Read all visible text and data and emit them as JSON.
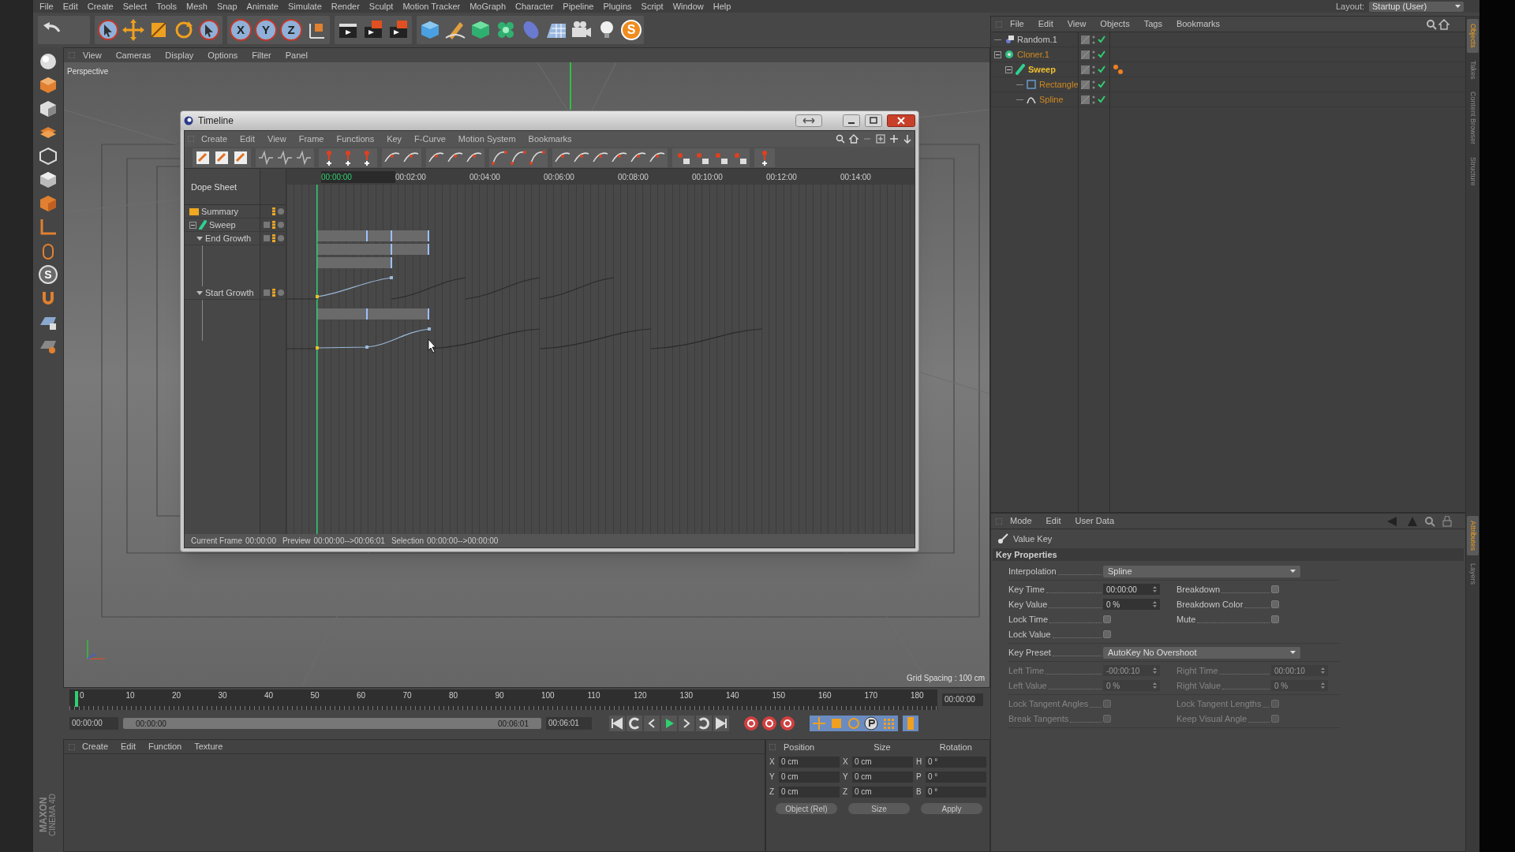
{
  "menu_bar": [
    "File",
    "Edit",
    "Create",
    "Select",
    "Tools",
    "Mesh",
    "Snap",
    "Animate",
    "Simulate",
    "Render",
    "Sculpt",
    "Motion Tracker",
    "MoGraph",
    "Character",
    "Pipeline",
    "Plugins",
    "Script",
    "Window",
    "Help"
  ],
  "layout": {
    "label": "Layout:",
    "value": "Startup (User)"
  },
  "main_toolbar": {
    "axis_buttons": [
      {
        "label": "X",
        "on": true
      },
      {
        "label": "Y",
        "on": true
      },
      {
        "label": "Z",
        "on": true
      }
    ],
    "badge": "S"
  },
  "left_toolbar": {
    "badge": "S"
  },
  "logo": [
    "MAXON",
    "CINEMA 4D"
  ],
  "viewport": {
    "menu": [
      "View",
      "Cameras",
      "Display",
      "Options",
      "Filter",
      "Panel"
    ],
    "label": "Perspective",
    "grid_spacing": "Grid Spacing : 100 cm"
  },
  "timeline_window": {
    "title": "Timeline",
    "menu": [
      "Create",
      "Edit",
      "View",
      "Frame",
      "Functions",
      "Key",
      "F-Curve",
      "Motion System",
      "Bookmarks"
    ],
    "mode": "Dope Sheet",
    "ruler": [
      "00:00:00",
      "00:02:00",
      "00:04:00",
      "00:06:00",
      "00:08:00",
      "00:10:00",
      "00:12:00",
      "00:14:00"
    ],
    "tracks": [
      {
        "name": "Summary",
        "kind": "summary"
      },
      {
        "name": "Sweep",
        "kind": "object",
        "expanded": true,
        "children": [
          {
            "name": "End Growth",
            "kind": "track",
            "expanded": true
          },
          {
            "name": "Start Growth",
            "kind": "track",
            "expanded": true
          }
        ]
      }
    ],
    "status": [
      {
        "label": "Current Frame",
        "value": "00:00:00"
      },
      {
        "label": "Preview",
        "value": "00:00:00-->00:06:01"
      },
      {
        "label": "Selection",
        "value": "00:00:00-->00:00:00"
      }
    ]
  },
  "object_manager": {
    "menu": [
      "File",
      "Edit",
      "View",
      "Objects",
      "Tags",
      "Bookmarks"
    ],
    "objects": [
      {
        "name": "Random.1",
        "kind": "effector",
        "selected": false,
        "animated": false
      },
      {
        "name": "Cloner.1",
        "kind": "cloner",
        "selected": true,
        "animated": false,
        "expanded": true,
        "children": [
          {
            "name": "Sweep",
            "kind": "sweep",
            "selected": true,
            "active": true,
            "animated": true,
            "expanded": true,
            "children": [
              {
                "name": "Rectangle",
                "kind": "rectangle",
                "selected": true,
                "animated": false
              },
              {
                "name": "Spline",
                "kind": "spline",
                "selected": true,
                "animated": false
              }
            ]
          }
        ]
      }
    ]
  },
  "object_tabs": [
    {
      "label": "Objects",
      "selected": true
    },
    {
      "label": "Takes",
      "selected": false
    },
    {
      "label": "Content Browser",
      "selected": false
    },
    {
      "label": "Structure",
      "selected": false
    }
  ],
  "attribute_tabs": [
    {
      "label": "Attributes",
      "selected": true
    },
    {
      "label": "Layers",
      "selected": false
    }
  ],
  "attributes": {
    "menu": [
      "Mode",
      "Edit",
      "User Data"
    ],
    "title": "Value Key",
    "section": "Key Properties",
    "groups": [
      [
        [
          {
            "kind": "dropdown",
            "label": "Interpolation",
            "value": "Spline",
            "disabled": false
          }
        ]
      ],
      [
        [
          {
            "kind": "field",
            "label": "Key Time",
            "value": "00:00:00",
            "disabled": false
          },
          {
            "kind": "checkbox",
            "label": "Breakdown",
            "checked": false,
            "disabled": false
          }
        ],
        [
          {
            "kind": "field",
            "label": "Key Value",
            "value": "0 %",
            "disabled": false
          },
          {
            "kind": "checkbox",
            "label": "Breakdown Color",
            "checked": false,
            "disabled": false
          }
        ],
        [
          {
            "kind": "checkbox",
            "label": "Lock Time",
            "checked": false,
            "disabled": false
          },
          {
            "kind": "checkbox",
            "label": "Mute",
            "checked": false,
            "disabled": false
          }
        ],
        [
          {
            "kind": "checkbox",
            "label": "Lock Value",
            "checked": false,
            "disabled": false
          }
        ]
      ],
      [
        [
          {
            "kind": "dropdown",
            "label": "Key Preset",
            "value": "AutoKey No Overshoot",
            "disabled": false
          }
        ]
      ],
      [
        [
          {
            "kind": "field",
            "label": "Left Time",
            "value": "-00:00:10",
            "disabled": true
          },
          {
            "kind": "field",
            "label": "Right Time",
            "value": "00:00:10",
            "disabled": true
          }
        ],
        [
          {
            "kind": "field",
            "label": "Left Value",
            "value": "0 %",
            "disabled": true
          },
          {
            "kind": "field",
            "label": "Right Value",
            "value": "0 %",
            "disabled": true
          }
        ]
      ],
      [
        [
          {
            "kind": "checkbox",
            "label": "Lock Tangent Angles",
            "checked": false,
            "disabled": true
          },
          {
            "kind": "checkbox",
            "label": "Lock Tangent Lengths",
            "checked": false,
            "disabled": true
          }
        ],
        [
          {
            "kind": "checkbox",
            "label": "Break Tangents",
            "checked": false,
            "disabled": true
          },
          {
            "kind": "checkbox",
            "label": "Keep Visual Angle",
            "checked": false,
            "disabled": true
          }
        ]
      ]
    ]
  },
  "animation_timeline": {
    "ticks": [
      "0",
      "10",
      "20",
      "30",
      "40",
      "50",
      "60",
      "70",
      "80",
      "90",
      "100",
      "110",
      "120",
      "130",
      "140",
      "150",
      "160",
      "170",
      "180"
    ],
    "current_time": "00:00:00",
    "playhead": {
      "level": 0
    },
    "start": "00:00:00",
    "range_start": "00:00:00",
    "range_end": "00:06:01",
    "range": {
      "level": 1
    },
    "end": "00:06:01"
  },
  "material_manager": {
    "menu": [
      "Create",
      "Edit",
      "Function",
      "Texture"
    ]
  },
  "coordinates": {
    "headers": [
      "Position",
      "Size",
      "Rotation"
    ],
    "rows": [
      [
        {
          "axis": "X",
          "value": "0 cm"
        },
        {
          "axis": "X",
          "value": "0 cm"
        },
        {
          "axis": "H",
          "value": "0 °"
        }
      ],
      [
        {
          "axis": "Y",
          "value": "0 cm"
        },
        {
          "axis": "Y",
          "value": "0 cm"
        },
        {
          "axis": "P",
          "value": "0 °"
        }
      ],
      [
        {
          "axis": "Z",
          "value": "0 cm"
        },
        {
          "axis": "Z",
          "value": "0 cm"
        },
        {
          "axis": "B",
          "value": "0 °"
        }
      ]
    ],
    "mode": "Object (Rel)",
    "size_mode": "Size",
    "apply": "Apply"
  }
}
